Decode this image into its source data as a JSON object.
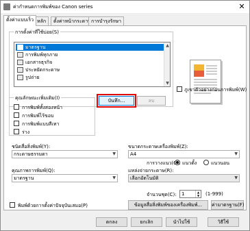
{
  "window": {
    "title": "ค่ากำหนดการพิมพ์ของ Canon series",
    "close_glyph": "✕"
  },
  "tabs": [
    "ตั้งค่าแบบเร็ว",
    "หลัก",
    "ตั้งค่าหน้ากระดาษ",
    "การบำรุงรักษา"
  ],
  "common_settings": {
    "label": "การตั้งค่าที่ใช้บ่อย(S)",
    "items": [
      "มาตรฐาน",
      "การพิมพ์ทุกภาย",
      "เอกสารธุรกิจ",
      "ประหยัดกระดาษ",
      "รูปถ่าย"
    ],
    "selected_index": 0,
    "save_button": "บันทึก...",
    "delete_button": "ลบ"
  },
  "always_preview_label": "ภูเขาตัวอย่างก่อนการพิมพ์(W)",
  "additional_features": {
    "label": "คุณลักษณะเพิ่มเติม(I)",
    "items": [
      "การพิมพ์ทั้งสองหน้า",
      "การพิมพ์ไร้ขอบ",
      "การพิมพ์แบบสีเทา",
      "ร่าง"
    ]
  },
  "media_type": {
    "label": "ชนิดสื่อสิ่งพิมพ์(Y):",
    "value": "กระดาษธรรมดา"
  },
  "printer_paper_size": {
    "label": "ขนาดกระดาษเครื่องพิมพ์(Z):",
    "value": "A4"
  },
  "orientation": {
    "label": "การวางแนว(O):",
    "portrait": "แนวตั้ง",
    "landscape": "แนวนอน",
    "selected": "portrait"
  },
  "print_quality": {
    "label": "คุณภาพการพิมพ์(Q):",
    "value": "มาตรฐาน"
  },
  "paper_source": {
    "label": "แหล่งจ่ายกระดาษ(R):",
    "value": "เลือกอัตโนมัติ"
  },
  "copies": {
    "label": "จำนวนชุด(C):",
    "value": "1",
    "range": "(1-999)"
  },
  "always_print_label": "พิมพ์ด้วยการตั้งค่าปัจจุบันเสมอ(P)",
  "printer_media_info_button": "ข้อมูลสื่อสิ่งพิมพ์ของเครื่องพิมพ์...",
  "defaults_button": "ค่ามาตรฐาน(F)",
  "footer": {
    "ok": "ตกลง",
    "cancel": "ยกเลิก",
    "apply": "นำไปใช้",
    "help": "วิธีใช้"
  }
}
